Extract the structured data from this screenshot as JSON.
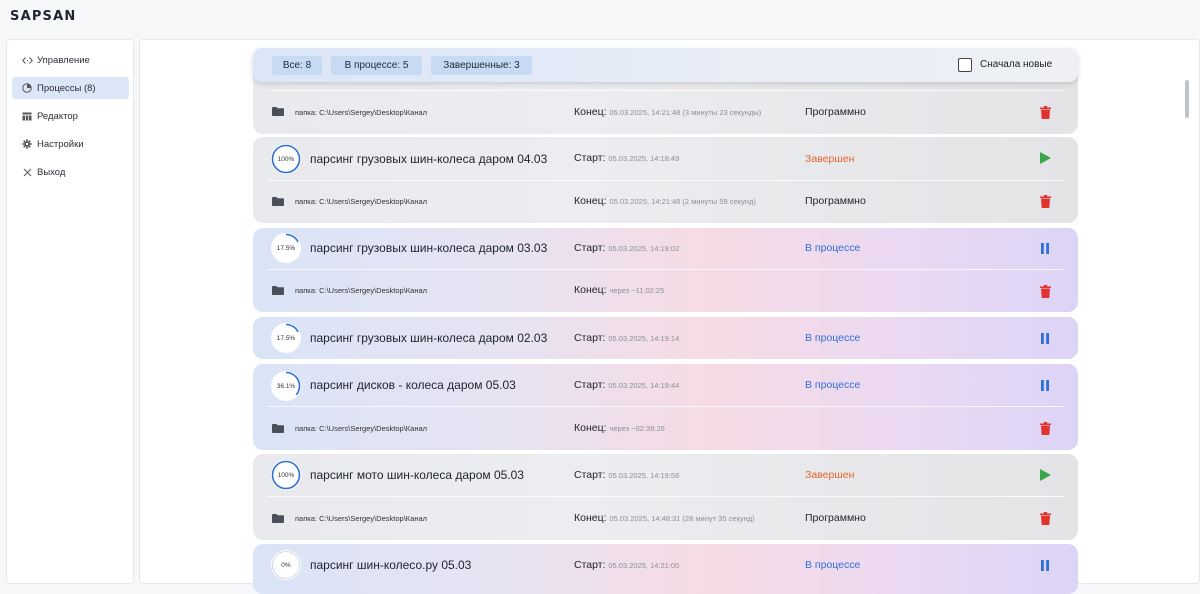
{
  "app": {
    "logo": "SAPSAN"
  },
  "sidebar": {
    "items": [
      {
        "label": "Управление",
        "icon": "code-icon"
      },
      {
        "label": "Процессы (8)",
        "icon": "process-icon",
        "active": true
      },
      {
        "label": "Редактор",
        "icon": "table-icon"
      },
      {
        "label": "Настройки",
        "icon": "gear-icon"
      },
      {
        "label": "Выход",
        "icon": "close-icon"
      }
    ]
  },
  "filters": {
    "all": "Все: 8",
    "in_progress": "В процессе: 5",
    "done": "Завершенные: 3",
    "newest_first": "Сначала новые",
    "newest_first_checked": false
  },
  "cards": [
    {
      "kind": "done",
      "path": "папка: C:\\Users\\Sergey\\Desktop\\Канал",
      "end_label": "Конец:",
      "end_value": "05.03.2025, 14:21:48 (3 минуты 23 секунды)",
      "mode": "Программно"
    },
    {
      "kind": "done",
      "progress": "100%",
      "title": "парсинг грузовых шин-колеса даром 04.03",
      "start_label": "Старт:",
      "start_value": "05.03.2025, 14:18:49",
      "status": "Завершен",
      "path": "папка: C:\\Users\\Sergey\\Desktop\\Канал",
      "end_label": "Конец:",
      "end_value": "05.03.2025, 14:21:48 (2 минуты 59 секунд)",
      "mode": "Программно"
    },
    {
      "kind": "proc",
      "progress": "17.5%",
      "title": "парсинг грузовых шин-колеса даром 03.03",
      "start_label": "Старт:",
      "start_value": "05.03.2025, 14:19:02",
      "status": "В процессе",
      "path": "папка: C:\\Users\\Sergey\\Desktop\\Канал",
      "end_label": "Конец:",
      "end_value": "через ~11:02:25"
    },
    {
      "kind": "proc",
      "progress": "17.5%",
      "title": "парсинг грузовых шин-колеса даром 02.03",
      "start_label": "Старт:",
      "start_value": "05.03.2025, 14:19:14",
      "status": "В процессе"
    },
    {
      "kind": "proc",
      "progress": "36.1%",
      "title": "парсинг дисков - колеса даром 05.03",
      "start_label": "Старт:",
      "start_value": "05.03.2025, 14:19:44",
      "status": "В процессе",
      "path": "папка: C:\\Users\\Sergey\\Desktop\\Канал",
      "end_label": "Конец:",
      "end_value": "через ~02:38:26"
    },
    {
      "kind": "done",
      "progress": "100%",
      "title": "парсинг мото шин-колеса даром 05.03",
      "start_label": "Старт:",
      "start_value": "05.03.2025, 14:19:56",
      "status": "Завершен",
      "path": "папка: C:\\Users\\Sergey\\Desktop\\Канал",
      "end_label": "Конец:",
      "end_value": "05.03.2025, 14:48:31 (28 минут 35 секунд)",
      "mode": "Программно"
    },
    {
      "kind": "proc",
      "progress": "0%",
      "title": "парсинг шин-колесо.ру 05.03",
      "start_label": "Старт:",
      "start_value": "05.03.2025, 14:21:00",
      "status": "В процессе"
    }
  ],
  "colors": {
    "accent": "#2e6fd8",
    "done_status": "#e5642b",
    "play": "#3aa64a",
    "delete": "#e0322f",
    "chip": "#c6daf4"
  }
}
